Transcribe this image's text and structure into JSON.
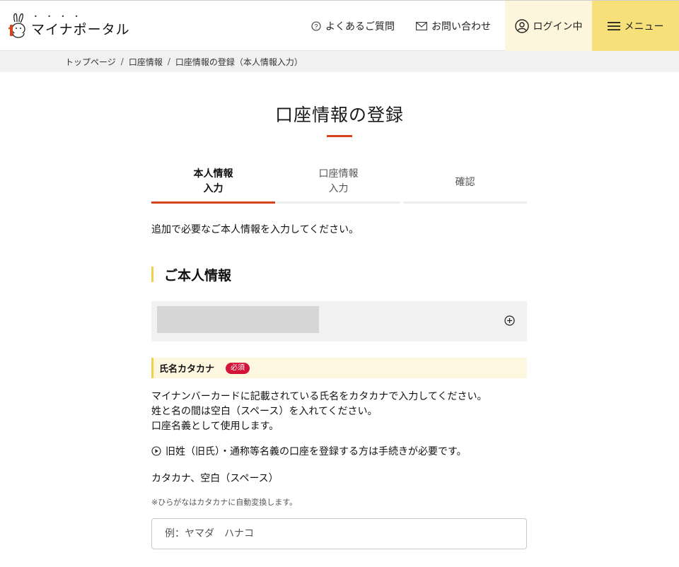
{
  "header": {
    "logo_text": "マイナポータル",
    "faq_label": "よくあるご質問",
    "contact_label": "お問い合わせ",
    "login_label": "ログイン中",
    "menu_label": "メニュー",
    "colors": {
      "login_bg": "#fdf6dc",
      "menu_bg": "#f7df7a"
    }
  },
  "breadcrumb": {
    "items": [
      "トップページ",
      "口座情報",
      "口座情報の登録（本人情報入力）"
    ],
    "separator": "/"
  },
  "page": {
    "title": "口座情報の登録",
    "accent_color": "#d6441a"
  },
  "steps": [
    {
      "line1": "本人情報",
      "line2": "入力",
      "active": true
    },
    {
      "line1": "口座情報",
      "line2": "入力",
      "active": false
    },
    {
      "line1": "確認",
      "line2": "",
      "active": false
    }
  ],
  "intro": "追加で必要なご本人情報を入力してください。",
  "section": {
    "title": "ご本人情報"
  },
  "field": {
    "label": "氏名カタカナ",
    "required_badge": "必須",
    "description": [
      "マイナンバーカードに記載されている氏名をカタカナで入力してください。",
      "姓と名の間は空白（スペース）を入れてください。",
      "口座名義として使用します。"
    ],
    "link_text": "旧姓（旧氏）・通称等名義の口座を登録する方は手続きが必要です。",
    "allowed_chars": "カタカナ、空白（スペース）",
    "note": "※ひらがなはカタカナに自動変換します。",
    "placeholder": "例：ヤマダ　ハナコ",
    "value": ""
  }
}
